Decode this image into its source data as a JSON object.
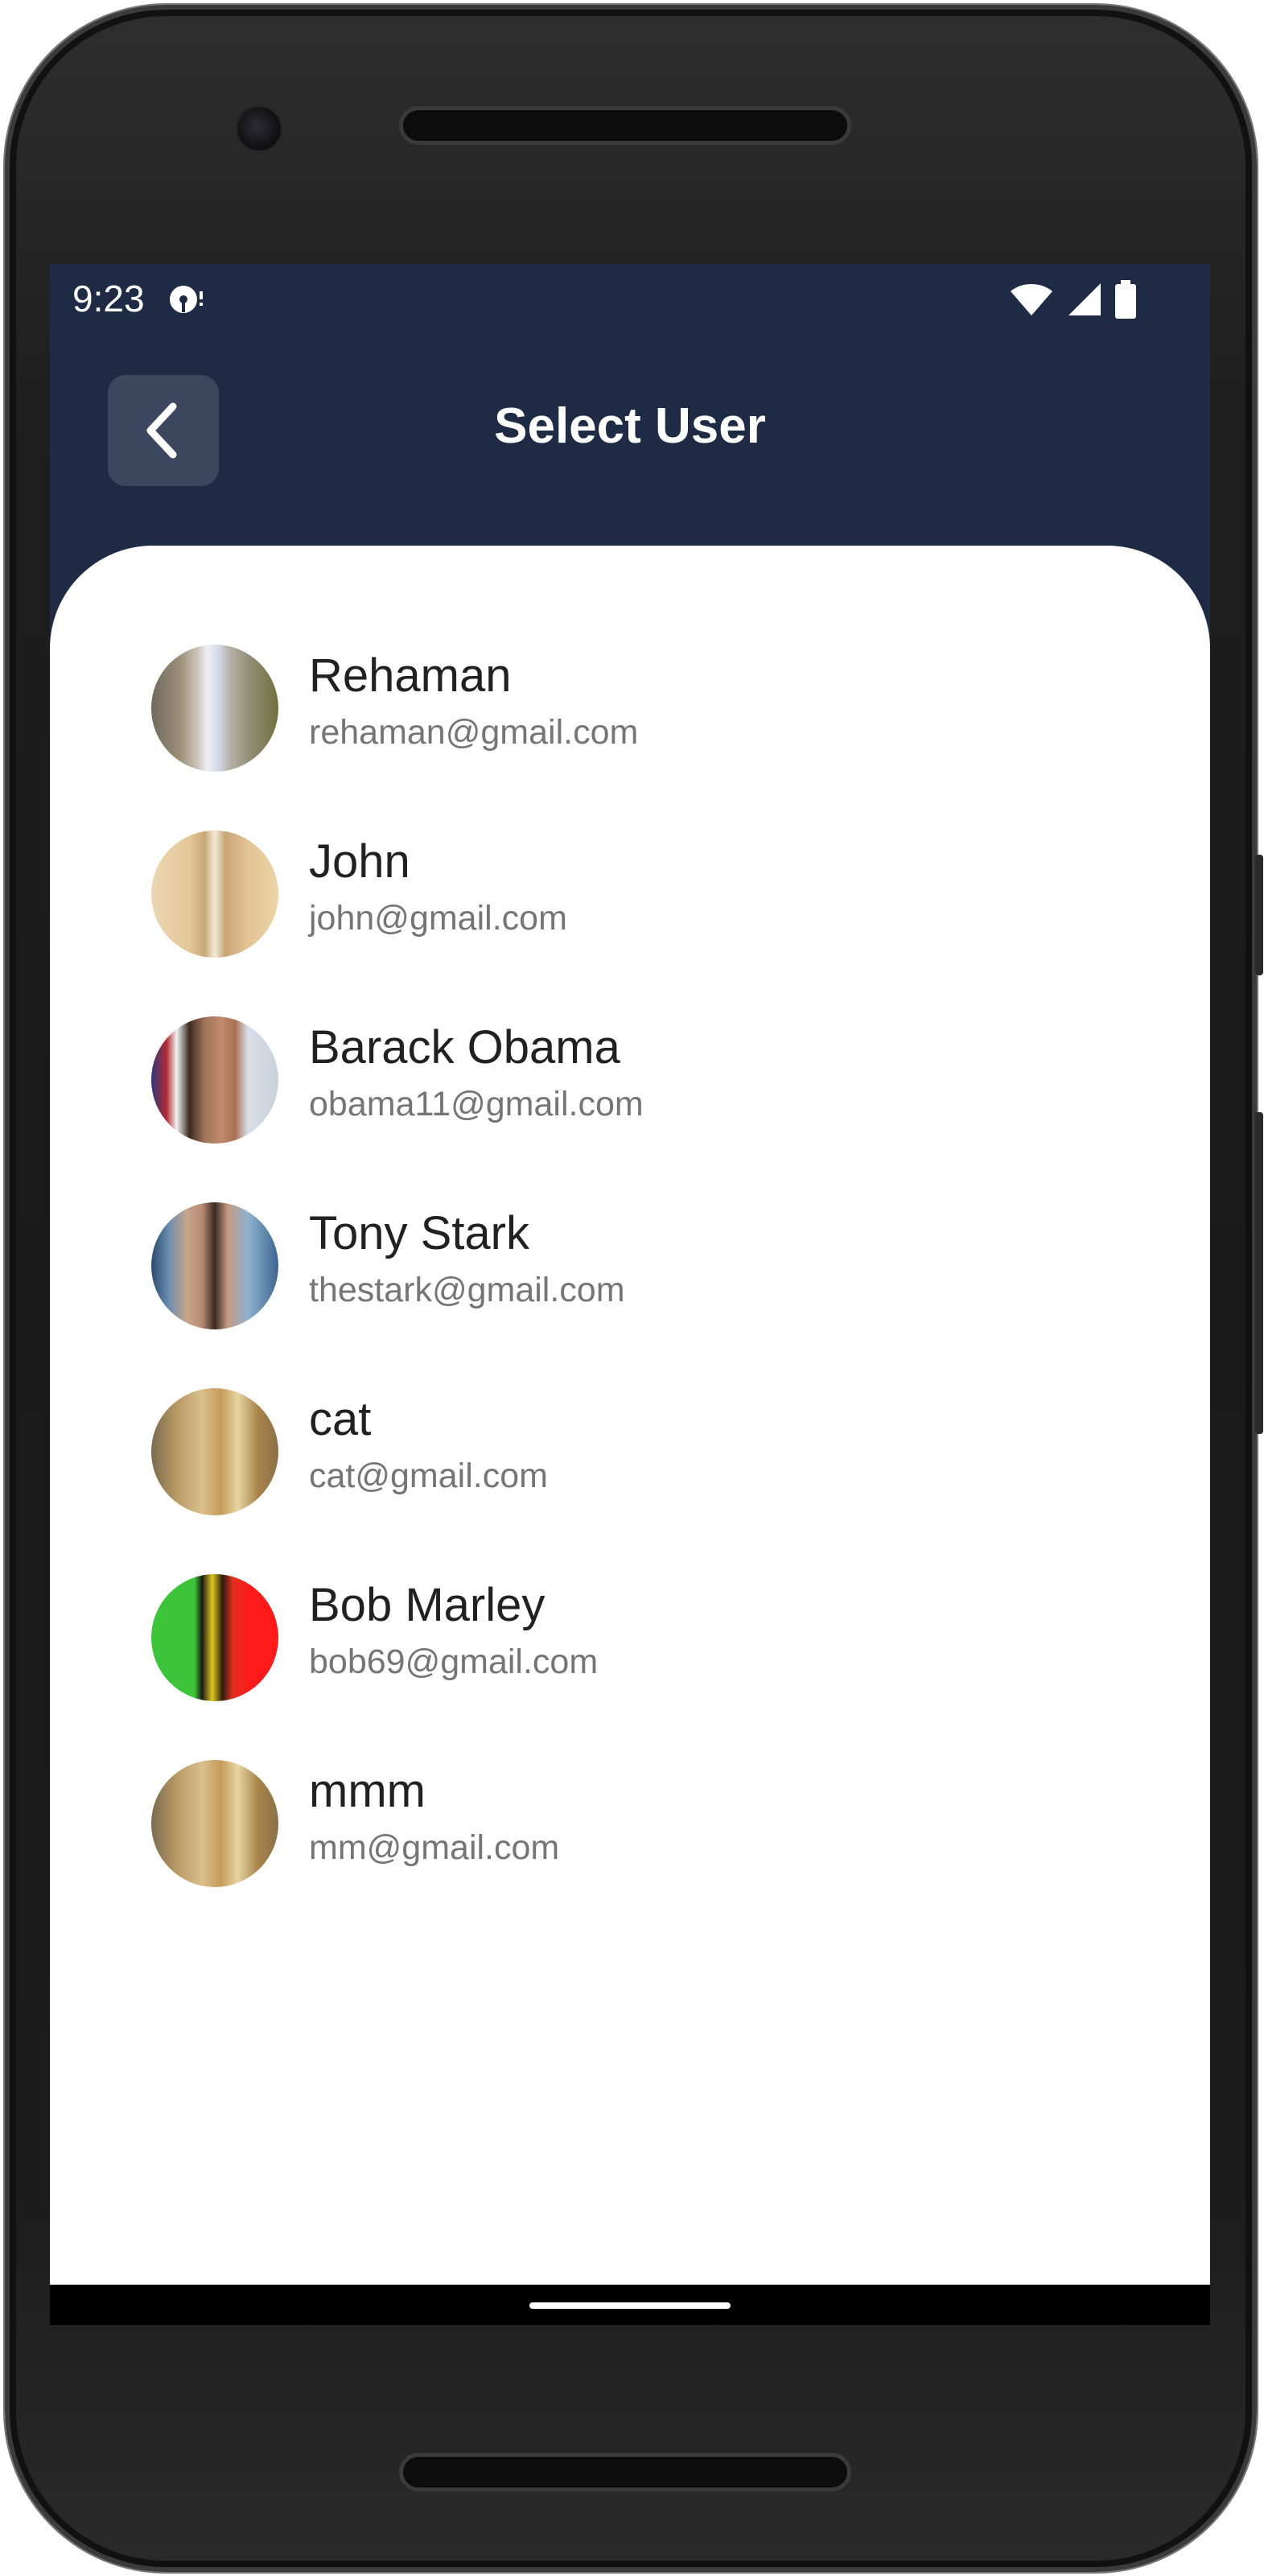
{
  "status_bar": {
    "time": "9:23",
    "notification_icon": "podcast-notification-icon",
    "wifi_icon": "wifi-icon",
    "signal_icon": "cell-signal-icon",
    "battery_icon": "battery-icon"
  },
  "header": {
    "title": "Select User",
    "back_icon": "chevron-left-icon",
    "background_color": "#1f2b45",
    "back_button_color": "#3c475f"
  },
  "users": [
    {
      "name": "Rehaman",
      "email": "rehaman@gmail.com"
    },
    {
      "name": "John",
      "email": "john@gmail.com"
    },
    {
      "name": "Barack Obama",
      "email": "obama11@gmail.com"
    },
    {
      "name": "Tony Stark",
      "email": "thestark@gmail.com"
    },
    {
      "name": "cat",
      "email": "cat@gmail.com"
    },
    {
      "name": "Bob Marley",
      "email": "bob69@gmail.com"
    },
    {
      "name": "mmm",
      "email": "mm@gmail.com"
    }
  ],
  "colors": {
    "name_text": "#212121",
    "email_text": "#757575",
    "content_background": "#ffffff"
  }
}
